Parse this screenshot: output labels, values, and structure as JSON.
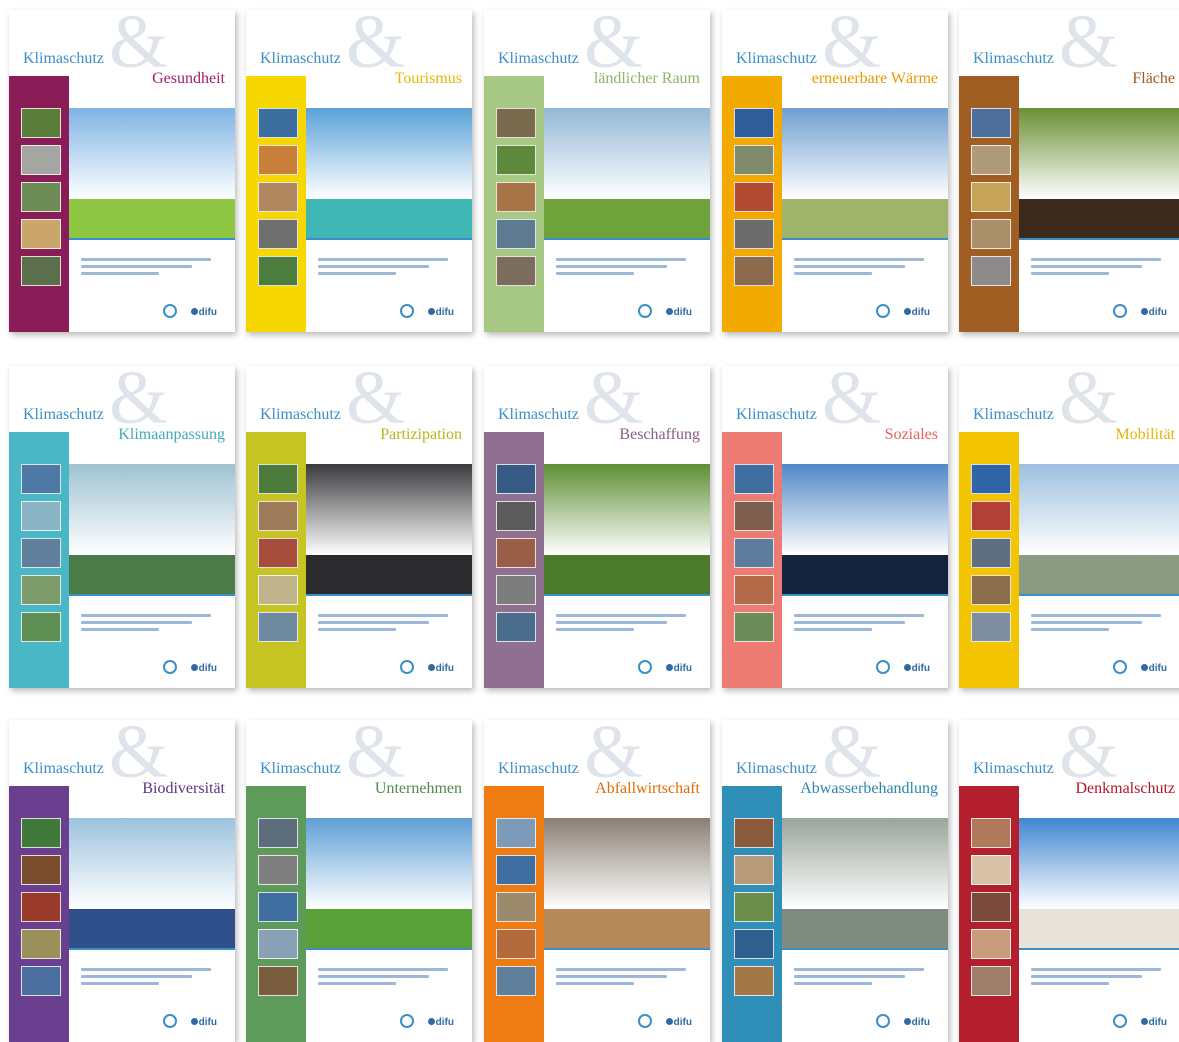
{
  "covers": [
    {
      "series": "Klimaschutz",
      "amp": "&",
      "topic": "Gesundheit",
      "band": "#8a1d58",
      "topic_color": "#a0206a",
      "sky": "#7fb4e4",
      "ground": "#8dc642",
      "thumbs": [
        "#5b7f3a",
        "#a5a8a2",
        "#6e8c55",
        "#caa66b",
        "#5c6f4d"
      ]
    },
    {
      "series": "Klimaschutz",
      "amp": "&",
      "topic": "Tourismus",
      "band": "#f6d800",
      "topic_color": "#e6b800",
      "sky": "#5aa2d8",
      "ground": "#3fb7b4",
      "thumbs": [
        "#3b6e9b",
        "#c8803a",
        "#b08860",
        "#6f6f70",
        "#4d7d3c"
      ]
    },
    {
      "series": "Klimaschutz",
      "amp": "&",
      "topic": "ländlicher Raum",
      "band": "#a7c985",
      "topic_color": "#8fb36a",
      "sky": "#93b8d6",
      "ground": "#6ea33c",
      "thumbs": [
        "#7a6a4e",
        "#5c8a3a",
        "#a87548",
        "#5f7b91",
        "#7c6c5e"
      ]
    },
    {
      "series": "Klimaschutz",
      "amp": "&",
      "topic": "erneuerbare Wärme",
      "band": "#f2a900",
      "topic_color": "#e99a00",
      "sky": "#6f9fd1",
      "ground": "#9fb46a",
      "thumbs": [
        "#2f5d9a",
        "#7f8a6c",
        "#b24a33",
        "#6c6c6c",
        "#8a6b4d"
      ]
    },
    {
      "series": "Klimaschutz",
      "amp": "&",
      "topic": "Fläche",
      "band": "#a15e23",
      "topic_color": "#a0581d",
      "sky": "#6a8f34",
      "ground": "#3c2a1d",
      "thumbs": [
        "#4e6f9c",
        "#b09a7c",
        "#c7a45a",
        "#a98e6a",
        "#8e8a8a"
      ]
    },
    {
      "series": "Klimaschutz",
      "amp": "&",
      "topic": "Klimaanpassung",
      "band": "#49b7c6",
      "topic_color": "#42aabb",
      "sky": "#9fc2d2",
      "ground": "#4c7d49",
      "thumbs": [
        "#4e79a6",
        "#8bb4c4",
        "#607f9d",
        "#7e9c6b",
        "#5f8f55"
      ]
    },
    {
      "series": "Klimaschutz",
      "amp": "&",
      "topic": "Partizipation",
      "band": "#c6c422",
      "topic_color": "#b8b51c",
      "sky": "#3a3b3d",
      "ground": "#2b2b2d",
      "thumbs": [
        "#4c7a3b",
        "#9c7a5a",
        "#a54c3c",
        "#c0b48c",
        "#6f8aa0"
      ]
    },
    {
      "series": "Klimaschutz",
      "amp": "&",
      "topic": "Beschaffung",
      "band": "#8f7090",
      "topic_color": "#8b5d84",
      "sky": "#5f8f35",
      "ground": "#4b7a2b",
      "thumbs": [
        "#355a84",
        "#5c5c5c",
        "#9a5e48",
        "#7d7d7d",
        "#4a6d8c"
      ]
    },
    {
      "series": "Klimaschutz",
      "amp": "&",
      "topic": "Soziales",
      "band": "#ee7a74",
      "topic_color": "#e6635d",
      "sky": "#4f88c6",
      "ground": "#15243d",
      "thumbs": [
        "#3f6fa1",
        "#7e5e4f",
        "#5e7c9c",
        "#b36b4a",
        "#6d8c5a"
      ]
    },
    {
      "series": "Klimaschutz",
      "amp": "&",
      "topic": "Mobilität",
      "band": "#f3c500",
      "topic_color": "#e8b400",
      "sky": "#9dc0e0",
      "ground": "#8c9a83",
      "thumbs": [
        "#2f64a6",
        "#b3413a",
        "#5f6f7f",
        "#8a6d4c",
        "#7f8f9f"
      ]
    },
    {
      "series": "Klimaschutz",
      "amp": "&",
      "topic": "Biodiversität",
      "band": "#6b3f8f",
      "topic_color": "#5b3380",
      "sky": "#9cc3df",
      "ground": "#2f4f8a",
      "thumbs": [
        "#3f7a3a",
        "#7a4d2e",
        "#9a3a2a",
        "#9b8f5a",
        "#4d6f9f"
      ]
    },
    {
      "series": "Klimaschutz",
      "amp": "&",
      "topic": "Unternehmen",
      "band": "#5e9b5a",
      "topic_color": "#4d8c48",
      "sky": "#5f9fd6",
      "ground": "#5aa13a",
      "thumbs": [
        "#5c6d7c",
        "#7f7f7f",
        "#3f6fa0",
        "#8aa0b4",
        "#7a5c3f"
      ]
    },
    {
      "series": "Klimaschutz",
      "amp": "&",
      "topic": "Abfallwirtschaft",
      "band": "#ef7b13",
      "topic_color": "#e36c00",
      "sky": "#8a7f73",
      "ground": "#b48a5a",
      "thumbs": [
        "#7d9bb8",
        "#3f6fa0",
        "#9c8a6c",
        "#b46a3c",
        "#5f7f9a"
      ]
    },
    {
      "series": "Klimaschutz",
      "amp": "&",
      "topic": "Abwasserbehandlung",
      "band": "#2f8fb8",
      "topic_color": "#2c86b1",
      "sky": "#9aa59c",
      "ground": "#7f8b80",
      "thumbs": [
        "#8a5a3c",
        "#b79a7a",
        "#6b8f4a",
        "#2f5f8f",
        "#a27848"
      ]
    },
    {
      "series": "Klimaschutz",
      "amp": "&",
      "topic": "Denkmalschutz",
      "band": "#b41f2e",
      "topic_color": "#b2182b",
      "sky": "#3f86d1",
      "ground": "#e9e4da",
      "thumbs": [
        "#b07a5a",
        "#d8c3a8",
        "#7a4a3a",
        "#c89b7a",
        "#9f7f6a"
      ]
    }
  ],
  "logo_label": "difu"
}
